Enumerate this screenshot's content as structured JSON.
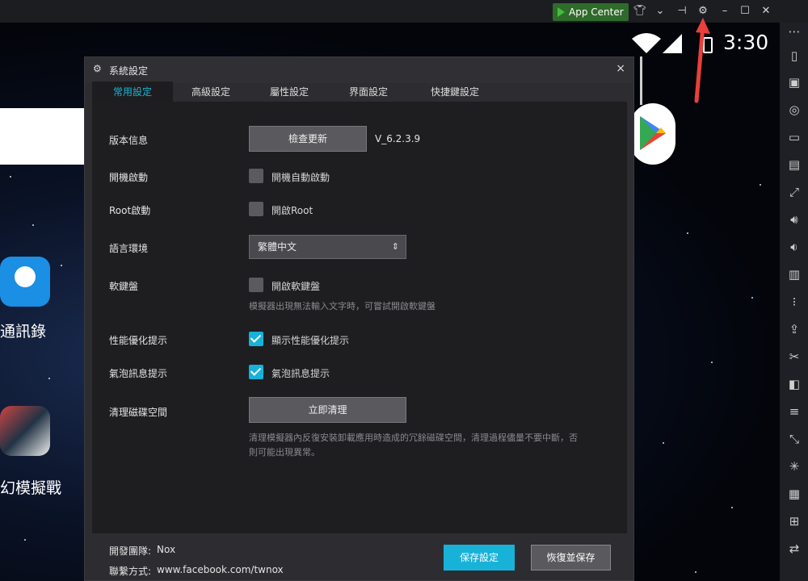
{
  "topbar": {
    "app_center": "App Center",
    "icons": [
      "shirt-icon",
      "chevron-down-icon",
      "pin-icon",
      "gear-icon",
      "minimize-icon",
      "maximize-icon",
      "close-icon"
    ]
  },
  "android": {
    "time": "3:30",
    "apps": [
      {
        "label": "通訊錄"
      },
      {
        "label": "幻模擬戰"
      }
    ]
  },
  "dialog": {
    "title": "系統設定",
    "close": "×",
    "tabs": [
      "常用設定",
      "高級設定",
      "屬性設定",
      "界面設定",
      "快捷鍵設定"
    ],
    "active_tab": 0,
    "version": {
      "label": "版本信息",
      "button": "檢查更新",
      "value": "V_6.2.3.9"
    },
    "autostart": {
      "label": "開機啟動",
      "checkbox": "開機自動啟動",
      "checked": false
    },
    "root": {
      "label": "Root啟動",
      "checkbox": "開啟Root",
      "checked": false
    },
    "language": {
      "label": "語言環境",
      "value": "繁體中文"
    },
    "keyboard": {
      "label": "軟鍵盤",
      "checkbox": "開啟軟鍵盤",
      "checked": false,
      "hint": "模擬器出現無法輸入文字時，可嘗試開啟軟鍵盤"
    },
    "perf": {
      "label": "性能優化提示",
      "checkbox": "顯示性能優化提示",
      "checked": true
    },
    "bubble": {
      "label": "氣泡訊息提示",
      "checkbox": "氣泡訊息提示",
      "checked": true
    },
    "disk": {
      "label": "清理磁碟空間",
      "button": "立即清理",
      "hint1": "清理模擬器內反復安裝卸載應用時造成的冗餘磁碟空間，清理過程儘量不要中斷，否",
      "hint2": "則可能出現異常。"
    },
    "footer": {
      "team_label": "開發團隊:",
      "team_value": "Nox",
      "contact_label": "聯繫方式:",
      "contact_value": "www.facebook.com/twnox",
      "save": "保存設定",
      "restore": "恢復並保存"
    }
  },
  "colors": {
    "accent": "#17b2d9",
    "dialog_bg": "#2d2d31",
    "body_bg": "#1e1e21",
    "arrow": "#e8403a"
  }
}
